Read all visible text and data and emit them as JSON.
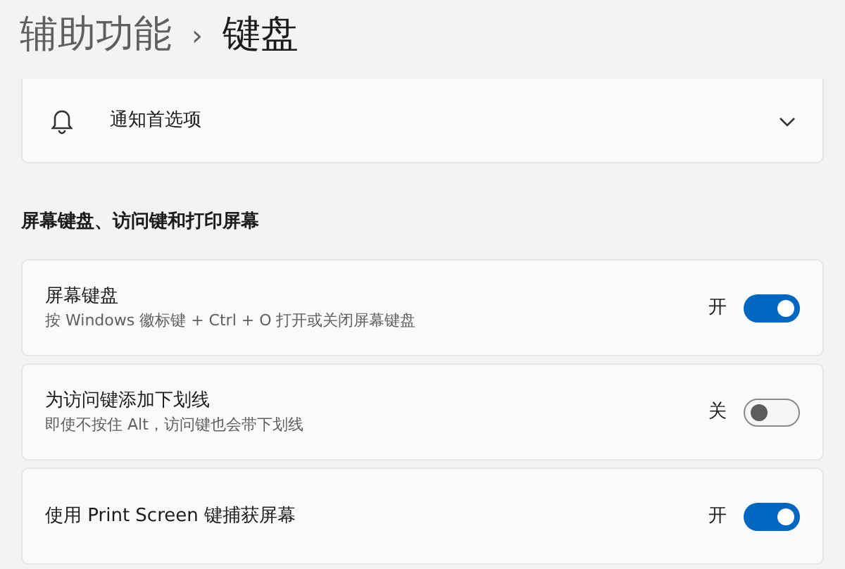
{
  "breadcrumb": {
    "parent": "辅助功能",
    "separator": "›",
    "current": "键盘"
  },
  "notification_card": {
    "label": "通知首选项",
    "expanded": false
  },
  "section": {
    "title": "屏幕键盘、访问键和打印屏幕"
  },
  "settings": [
    {
      "title": "屏幕键盘",
      "description": "按 Windows 徽标键 + Ctrl + O 打开或关闭屏幕键盘",
      "state_label": "开",
      "on": true
    },
    {
      "title": "为访问键添加下划线",
      "description": "即使不按住 Alt，访问键也会带下划线",
      "state_label": "关",
      "on": false
    },
    {
      "title": "使用 Print Screen 键捕获屏幕",
      "state_label": "开",
      "on": true
    }
  ]
}
